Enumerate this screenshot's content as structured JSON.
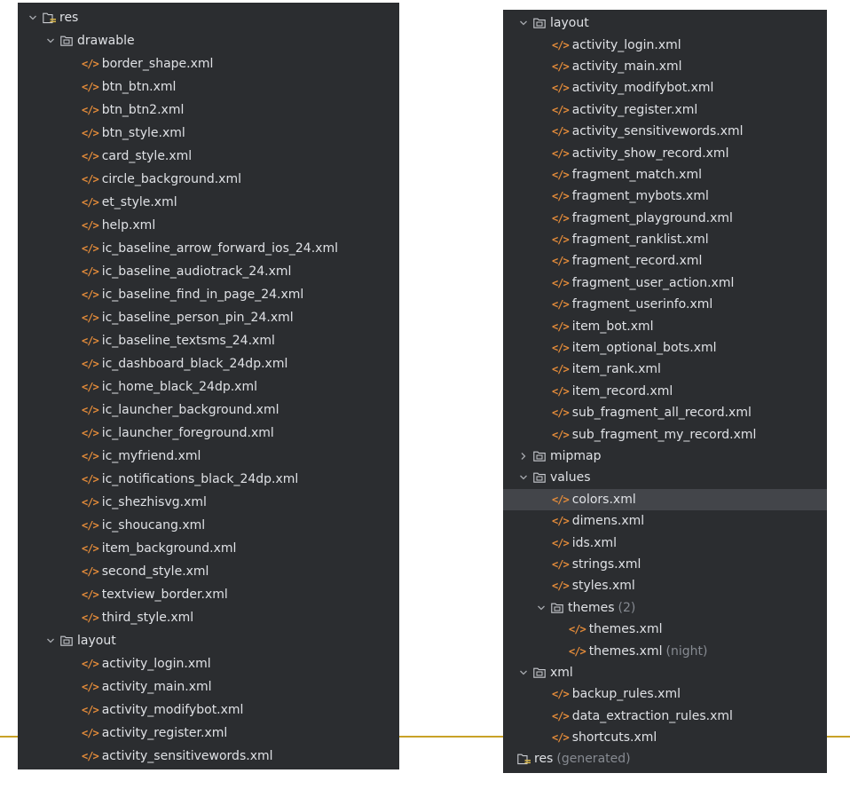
{
  "ui": {
    "xml_glyph": "</>"
  },
  "left_tree": {
    "root": "res",
    "drawable": {
      "label": "drawable",
      "files": [
        "border_shape.xml",
        "btn_btn.xml",
        "btn_btn2.xml",
        "btn_style.xml",
        "card_style.xml",
        "circle_background.xml",
        "et_style.xml",
        "help.xml",
        "ic_baseline_arrow_forward_ios_24.xml",
        "ic_baseline_audiotrack_24.xml",
        "ic_baseline_find_in_page_24.xml",
        "ic_baseline_person_pin_24.xml",
        "ic_baseline_textsms_24.xml",
        "ic_dashboard_black_24dp.xml",
        "ic_home_black_24dp.xml",
        "ic_launcher_background.xml",
        "ic_launcher_foreground.xml",
        "ic_myfriend.xml",
        "ic_notifications_black_24dp.xml",
        "ic_shezhisvg.xml",
        "ic_shoucang.xml",
        "item_background.xml",
        "second_style.xml",
        "textview_border.xml",
        "third_style.xml"
      ]
    },
    "layout": {
      "label": "layout",
      "files": [
        "activity_login.xml",
        "activity_main.xml",
        "activity_modifybot.xml",
        "activity_register.xml",
        "activity_sensitivewords.xml"
      ]
    }
  },
  "right_tree": {
    "layout": {
      "label": "layout",
      "files": [
        "activity_login.xml",
        "activity_main.xml",
        "activity_modifybot.xml",
        "activity_register.xml",
        "activity_sensitivewords.xml",
        "activity_show_record.xml",
        "fragment_match.xml",
        "fragment_mybots.xml",
        "fragment_playground.xml",
        "fragment_ranklist.xml",
        "fragment_record.xml",
        "fragment_user_action.xml",
        "fragment_userinfo.xml",
        "item_bot.xml",
        "item_optional_bots.xml",
        "item_rank.xml",
        "item_record.xml",
        "sub_fragment_all_record.xml",
        "sub_fragment_my_record.xml"
      ]
    },
    "mipmap": {
      "label": "mipmap"
    },
    "values": {
      "label": "values",
      "files": [
        "colors.xml",
        "dimens.xml",
        "ids.xml",
        "strings.xml",
        "styles.xml"
      ],
      "themes": {
        "label": "themes",
        "count": "(2)",
        "files": [
          {
            "name": "themes.xml",
            "qualifier": ""
          },
          {
            "name": "themes.xml",
            "qualifier": "(night)"
          }
        ]
      }
    },
    "xml": {
      "label": "xml",
      "files": [
        "backup_rules.xml",
        "data_extraction_rules.xml",
        "shortcuts.xml"
      ]
    },
    "generated": {
      "label": "res",
      "suffix": "(generated)"
    }
  },
  "colors": {
    "panel_bg": "#2b2d30",
    "text": "#dfe1e5",
    "muted": "#868a91",
    "xml_icon": "#e38b3a",
    "selection": "#43454a",
    "accent_line": "#c9a227"
  }
}
